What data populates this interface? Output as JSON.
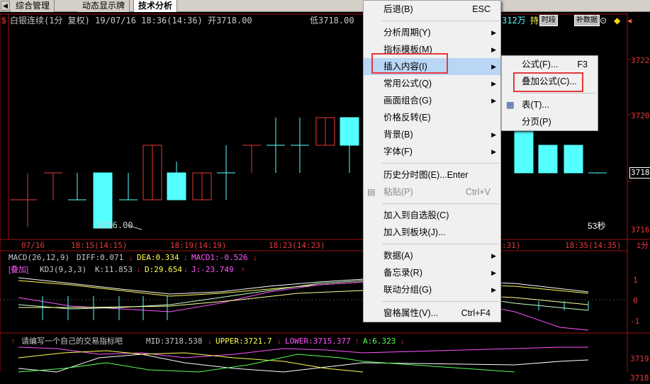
{
  "tabs": [
    "综合管理",
    "动态显示牌",
    "技术分析"
  ],
  "header": {
    "symbol_icon": "$",
    "title": "白银连续(1分 复权) 19/07/16 18:36(14:36) 开3718.00",
    "low_text": "低3718.00",
    "right_value": "312万",
    "right_label": "持",
    "btn_shiduan": "时段",
    "btn_buyshuju": "补数据"
  },
  "price_axis": [
    "3722",
    "3720",
    "3718",
    "3716"
  ],
  "time_axis": [
    "07/16",
    "18:15(14:15)",
    "18:19(14:19)",
    "18:23(14:23)",
    ":31)",
    "18:35(14:35)"
  ],
  "time_axis_right": "1分",
  "chart_annotations": {
    "low_label": "3716.00",
    "countdown": "53秒"
  },
  "macd": {
    "label": "MACD(26,12,9)",
    "diff": "DIFF:0.071",
    "dea": "DEA:0.334",
    "macd1": "MACD1:-0.526",
    "overlay_tag": "[叠加]",
    "kdj": "KDJ(9,3,3)",
    "k": "K:11.853",
    "d": "D:29.654",
    "j": "J:-23.749",
    "axis": [
      "1",
      "0",
      "-1"
    ]
  },
  "custom": {
    "prompt": "请编写一个自己的交易指标吧",
    "mid": "MID:3718.538",
    "upper": "UPPER:3721.7",
    "lower": "LOWER:3715.377",
    "a": "A:6.323",
    "axis": [
      "3719",
      "3718"
    ]
  },
  "menu": {
    "items": [
      {
        "label": "后退(B)",
        "shortcut": "ESC"
      },
      {
        "label": "分析周期(Y)",
        "sub": true
      },
      {
        "label": "指标模板(M)",
        "sub": true
      },
      {
        "label": "插入内容(I)",
        "sub": true,
        "highlight": true
      },
      {
        "label": "常用公式(Q)",
        "sub": true
      },
      {
        "label": "画面组合(G)",
        "sub": true
      },
      {
        "label": "价格反转(E)"
      },
      {
        "label": "背景(B)",
        "sub": true
      },
      {
        "label": "字体(F)",
        "sub": true
      },
      {
        "label": "历史分时图(E)...Enter"
      },
      {
        "label": "粘贴(P)",
        "shortcut": "Ctrl+V",
        "disabled": true
      },
      {
        "label": "加入到自选股(C)"
      },
      {
        "label": "加入到板块(J)..."
      },
      {
        "label": "数据(A)",
        "sub": true
      },
      {
        "label": "备忘录(R)",
        "sub": true
      },
      {
        "label": "联动分组(G)",
        "sub": true
      },
      {
        "label": "窗格属性(V)...",
        "shortcut": "Ctrl+F4"
      }
    ]
  },
  "submenu": {
    "items": [
      {
        "label": "公式(F)...",
        "shortcut": "F3"
      },
      {
        "label": "叠加公式(C)..."
      },
      {
        "label": "表(T)..."
      },
      {
        "label": "分页(P)"
      }
    ]
  },
  "colors": {
    "up": "#e8383a",
    "down": "#54ffff",
    "yellow": "#ffff54",
    "magenta": "#ff54ff",
    "green": "#54ff54",
    "axis": "#a01010"
  }
}
